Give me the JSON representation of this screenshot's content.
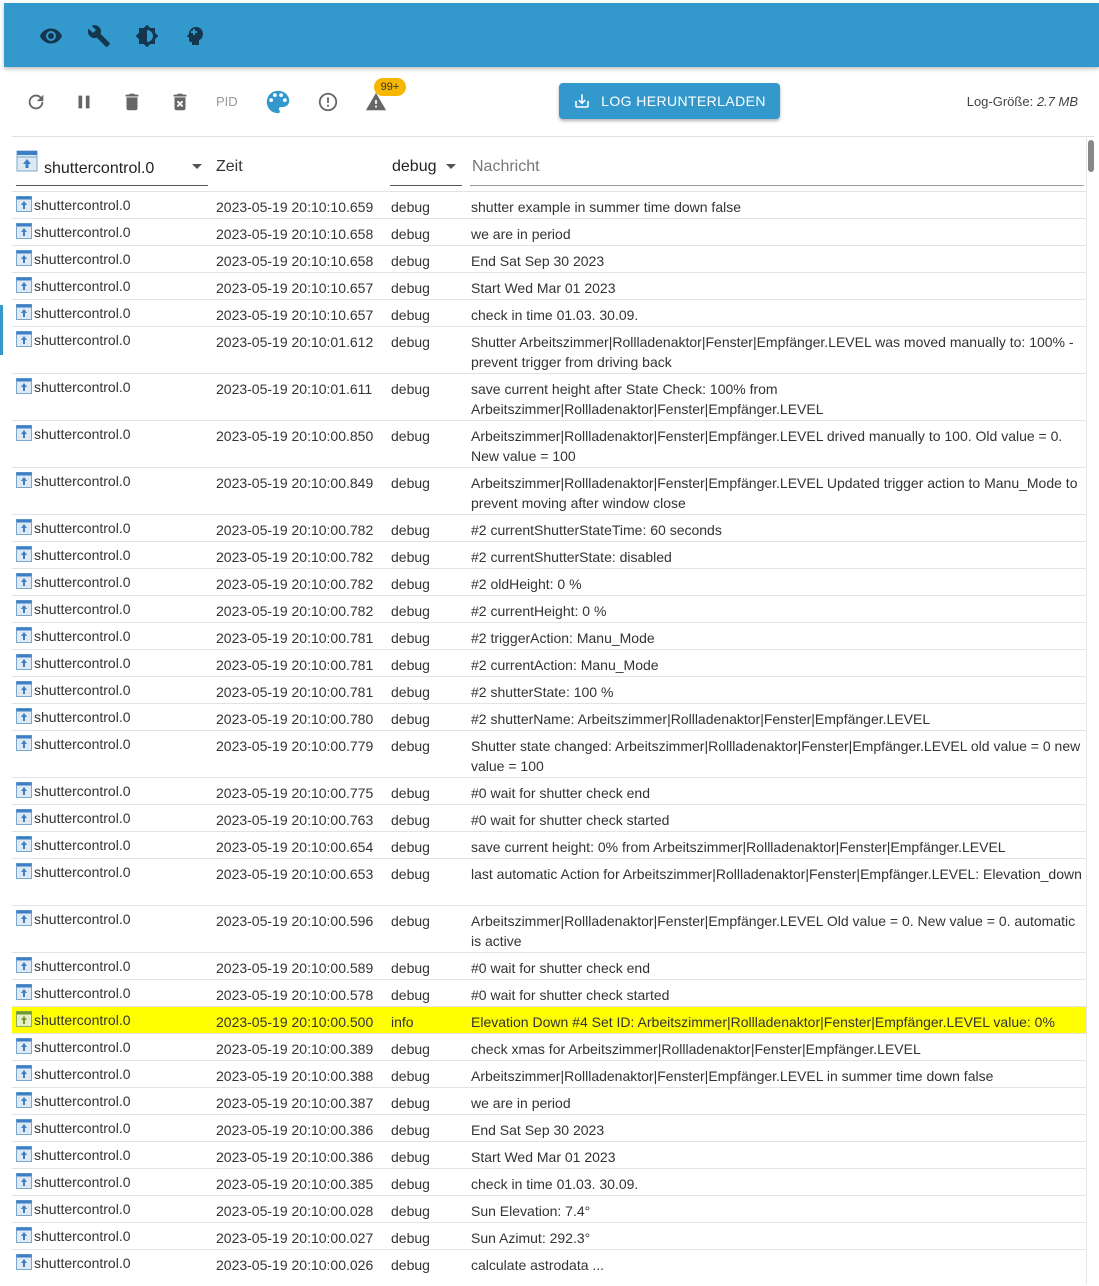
{
  "topbar": {
    "icons": [
      "eye-icon",
      "wrench-icon",
      "brightness-icon",
      "head-icon"
    ]
  },
  "toolbar": {
    "icons": [
      "refresh-icon",
      "pause-icon",
      "delete-icon",
      "delete-all-icon",
      "palette-icon",
      "error-icon",
      "warning-icon"
    ],
    "pid_label": "PID",
    "warning_badge": "99+",
    "download_label": "LOG HERUNTERLADEN",
    "log_size_label": "Log-Größe: ",
    "log_size_value": "2.7 MB"
  },
  "header": {
    "adapter_filter": "shuttercontrol.0",
    "time_label": "Zeit",
    "severity_filter": "debug",
    "message_placeholder": "Nachricht"
  },
  "colors": {
    "accent": "#3399cc",
    "highlight": "#ffff00",
    "badge": "#f7b700"
  },
  "rows": [
    {
      "source": "shuttercontrol.0",
      "time": "2023-05-19 20:10:10.659",
      "severity": "debug",
      "message": "shutter example in summer time down false"
    },
    {
      "source": "shuttercontrol.0",
      "time": "2023-05-19 20:10:10.658",
      "severity": "debug",
      "message": "we are in period"
    },
    {
      "source": "shuttercontrol.0",
      "time": "2023-05-19 20:10:10.658",
      "severity": "debug",
      "message": "End Sat Sep 30 2023"
    },
    {
      "source": "shuttercontrol.0",
      "time": "2023-05-19 20:10:10.657",
      "severity": "debug",
      "message": "Start Wed Mar 01 2023"
    },
    {
      "source": "shuttercontrol.0",
      "time": "2023-05-19 20:10:10.657",
      "severity": "debug",
      "message": "check in time 01.03. 30.09."
    },
    {
      "source": "shuttercontrol.0",
      "time": "2023-05-19 20:10:01.612",
      "severity": "debug",
      "message": "Shutter Arbeitszimmer|Rollladenaktor|Fenster|Empfänger.LEVEL was moved manually to: 100% - prevent trigger from driving back"
    },
    {
      "source": "shuttercontrol.0",
      "time": "2023-05-19 20:10:01.611",
      "severity": "debug",
      "message": "save current height after State Check: 100% from Arbeitszimmer|Rollladenaktor|Fenster|Empfänger.LEVEL"
    },
    {
      "source": "shuttercontrol.0",
      "time": "2023-05-19 20:10:00.850",
      "severity": "debug",
      "message": "Arbeitszimmer|Rollladenaktor|Fenster|Empfänger.LEVEL drived manually to 100. Old value = 0. New value = 100"
    },
    {
      "source": "shuttercontrol.0",
      "time": "2023-05-19 20:10:00.849",
      "severity": "debug",
      "message": "Arbeitszimmer|Rollladenaktor|Fenster|Empfänger.LEVEL Updated trigger action to Manu_Mode to prevent moving after window close"
    },
    {
      "source": "shuttercontrol.0",
      "time": "2023-05-19 20:10:00.782",
      "severity": "debug",
      "message": "#2 currentShutterStateTime: 60 seconds"
    },
    {
      "source": "shuttercontrol.0",
      "time": "2023-05-19 20:10:00.782",
      "severity": "debug",
      "message": "#2 currentShutterState: disabled"
    },
    {
      "source": "shuttercontrol.0",
      "time": "2023-05-19 20:10:00.782",
      "severity": "debug",
      "message": "#2 oldHeight: 0 %"
    },
    {
      "source": "shuttercontrol.0",
      "time": "2023-05-19 20:10:00.782",
      "severity": "debug",
      "message": "#2 currentHeight: 0 %"
    },
    {
      "source": "shuttercontrol.0",
      "time": "2023-05-19 20:10:00.781",
      "severity": "debug",
      "message": "#2 triggerAction: Manu_Mode"
    },
    {
      "source": "shuttercontrol.0",
      "time": "2023-05-19 20:10:00.781",
      "severity": "debug",
      "message": "#2 currentAction: Manu_Mode"
    },
    {
      "source": "shuttercontrol.0",
      "time": "2023-05-19 20:10:00.781",
      "severity": "debug",
      "message": "#2 shutterState: 100 %"
    },
    {
      "source": "shuttercontrol.0",
      "time": "2023-05-19 20:10:00.780",
      "severity": "debug",
      "message": "#2 shutterName: Arbeitszimmer|Rollladenaktor|Fenster|Empfänger.LEVEL"
    },
    {
      "source": "shuttercontrol.0",
      "time": "2023-05-19 20:10:00.779",
      "severity": "debug",
      "message": "Shutter state changed: Arbeitszimmer|Rollladenaktor|Fenster|Empfänger.LEVEL old value = 0 new value = 100"
    },
    {
      "source": "shuttercontrol.0",
      "time": "2023-05-19 20:10:00.775",
      "severity": "debug",
      "message": "#0 wait for shutter check end"
    },
    {
      "source": "shuttercontrol.0",
      "time": "2023-05-19 20:10:00.763",
      "severity": "debug",
      "message": "#0 wait for shutter check started"
    },
    {
      "source": "shuttercontrol.0",
      "time": "2023-05-19 20:10:00.654",
      "severity": "debug",
      "message": "save current height: 0% from Arbeitszimmer|Rollladenaktor|Fenster|Empfänger.LEVEL"
    },
    {
      "source": "shuttercontrol.0",
      "time": "2023-05-19 20:10:00.653",
      "severity": "debug",
      "message": "last automatic Action for Arbeitszimmer|Rollladenaktor|Fenster|Empfänger.LEVEL: Elevation_down"
    },
    {
      "source": "shuttercontrol.0",
      "time": "2023-05-19 20:10:00.596",
      "severity": "debug",
      "message": "Arbeitszimmer|Rollladenaktor|Fenster|Empfänger.LEVEL Old value = 0. New value = 0. automatic is active"
    },
    {
      "source": "shuttercontrol.0",
      "time": "2023-05-19 20:10:00.589",
      "severity": "debug",
      "message": "#0 wait for shutter check end"
    },
    {
      "source": "shuttercontrol.0",
      "time": "2023-05-19 20:10:00.578",
      "severity": "debug",
      "message": "#0 wait for shutter check started"
    },
    {
      "source": "shuttercontrol.0",
      "time": "2023-05-19 20:10:00.500",
      "severity": "info",
      "message": "Elevation Down #4 Set ID: Arbeitszimmer|Rollladenaktor|Fenster|Empfänger.LEVEL value: 0%",
      "highlighted": true
    },
    {
      "source": "shuttercontrol.0",
      "time": "2023-05-19 20:10:00.389",
      "severity": "debug",
      "message": "check xmas for Arbeitszimmer|Rollladenaktor|Fenster|Empfänger.LEVEL"
    },
    {
      "source": "shuttercontrol.0",
      "time": "2023-05-19 20:10:00.388",
      "severity": "debug",
      "message": "Arbeitszimmer|Rollladenaktor|Fenster|Empfänger.LEVEL in summer time down false"
    },
    {
      "source": "shuttercontrol.0",
      "time": "2023-05-19 20:10:00.387",
      "severity": "debug",
      "message": "we are in period"
    },
    {
      "source": "shuttercontrol.0",
      "time": "2023-05-19 20:10:00.386",
      "severity": "debug",
      "message": "End Sat Sep 30 2023"
    },
    {
      "source": "shuttercontrol.0",
      "time": "2023-05-19 20:10:00.386",
      "severity": "debug",
      "message": "Start Wed Mar 01 2023"
    },
    {
      "source": "shuttercontrol.0",
      "time": "2023-05-19 20:10:00.385",
      "severity": "debug",
      "message": "check in time 01.03. 30.09."
    },
    {
      "source": "shuttercontrol.0",
      "time": "2023-05-19 20:10:00.028",
      "severity": "debug",
      "message": "Sun Elevation: 7.4°"
    },
    {
      "source": "shuttercontrol.0",
      "time": "2023-05-19 20:10:00.027",
      "severity": "debug",
      "message": "Sun Azimut: 292.3°"
    },
    {
      "source": "shuttercontrol.0",
      "time": "2023-05-19 20:10:00.026",
      "severity": "debug",
      "message": "calculate astrodata ..."
    }
  ]
}
